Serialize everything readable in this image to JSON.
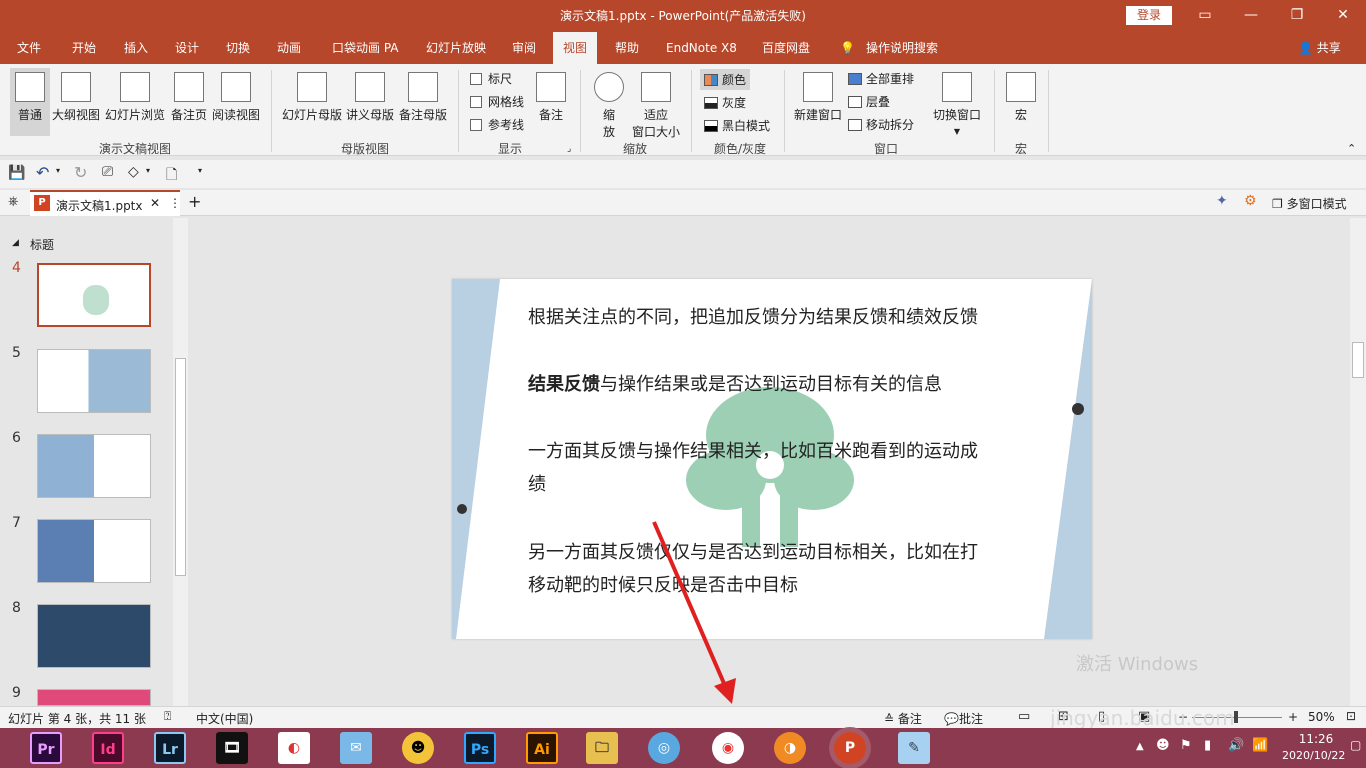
{
  "window": {
    "title": "演示文稿1.pptx  -  PowerPoint(产品激活失败)",
    "login": "登录"
  },
  "tabs": [
    {
      "label": "文件"
    },
    {
      "label": "开始"
    },
    {
      "label": "插入"
    },
    {
      "label": "设计"
    },
    {
      "label": "切换"
    },
    {
      "label": "动画"
    },
    {
      "label": "口袋动画 PA"
    },
    {
      "label": "幻灯片放映"
    },
    {
      "label": "审阅"
    },
    {
      "label": "视图"
    },
    {
      "label": "帮助"
    },
    {
      "label": "EndNote X8"
    },
    {
      "label": "百度网盘"
    },
    {
      "label": "操作说明搜索"
    }
  ],
  "share": "共享",
  "ribbon": {
    "presentation_views": {
      "label": "演示文稿视图",
      "buttons": [
        "普通",
        "大纲视图",
        "幻灯片浏览",
        "备注页",
        "阅读视图"
      ]
    },
    "master_views": {
      "label": "母版视图",
      "buttons": [
        "幻灯片母版",
        "讲义母版",
        "备注母版"
      ]
    },
    "show": {
      "label": "显示",
      "checks": [
        "标尺",
        "网格线",
        "参考线"
      ],
      "notes": "备注"
    },
    "zoom": {
      "label": "缩放",
      "zoom1": "缩",
      "zoom2": "放",
      "fit1": "适应",
      "fit2": "窗口大小"
    },
    "color": {
      "label": "颜色/灰度",
      "items": [
        "颜色",
        "灰度",
        "黑白模式"
      ]
    },
    "window": {
      "label": "窗口",
      "new_window": "新建窗口",
      "arrange": "全部重排",
      "cascade": "层叠",
      "move_split": "移动拆分",
      "switch": "切换窗口"
    },
    "macros": {
      "label": "宏",
      "button": "宏"
    }
  },
  "doc_tab": {
    "name": "演示文稿1.pptx",
    "multiwindow": "多窗口模式"
  },
  "slide_pane": {
    "section": "标题",
    "thumb_numbers": [
      "4",
      "5",
      "6",
      "7",
      "8",
      "9"
    ]
  },
  "slide": {
    "lines": [
      "根据关注点的不同，把追加反馈分为结果反馈和绩效反馈",
      "结果反馈",
      "与操作结果或是否达到运动目标有关的信息",
      "一方面其反馈与操作结果相关，比如百米跑看到的运动成",
      "绩",
      "另一方面其反馈仅仅与是否达到运动目标相关，比如在打",
      "移动靶的时候只反映是否击中目标"
    ]
  },
  "status": {
    "slide_info": "幻灯片 第 4 张，共 11 张",
    "language": "中文(中国)",
    "notes": "备注",
    "comments": "批注",
    "zoom": "50%"
  },
  "watermark": {
    "activate": "激活 Windows",
    "site": "jingyan.baidu.com"
  },
  "taskbar": {
    "apps": [
      "Pr",
      "Id",
      "Lr",
      "Ps",
      "Ai",
      "P"
    ],
    "time": "11:26",
    "date": "2020/10/22"
  },
  "colors": {
    "accent": "#b7472a",
    "taskbar": "#8b3a50"
  }
}
